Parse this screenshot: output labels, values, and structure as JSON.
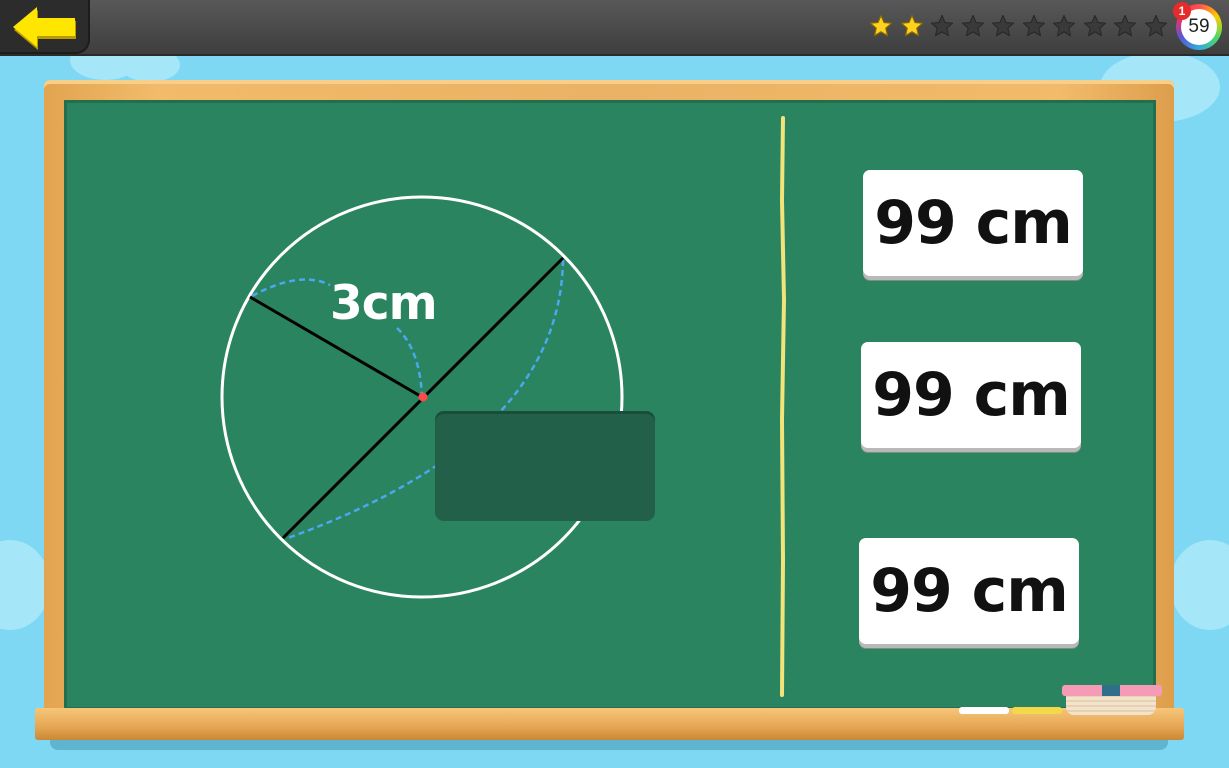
{
  "header": {
    "back_icon": "arrow-left-icon",
    "stars_total": 10,
    "stars_earned": 2,
    "score": "59",
    "notification_count": "1"
  },
  "problem": {
    "radius_label": "3cm"
  },
  "answers": [
    {
      "label": "99 cm"
    },
    {
      "label": "99 cm"
    },
    {
      "label": "99 cm"
    }
  ],
  "colors": {
    "background": "#7fd8f3",
    "chalkboard": "#2b8460",
    "frame": "#eab264",
    "star_filled": "#ffd21f",
    "star_empty": "#3a3a3a",
    "chalk_divider": "#f2e47a",
    "dashed_arc": "#4aa8f0"
  }
}
